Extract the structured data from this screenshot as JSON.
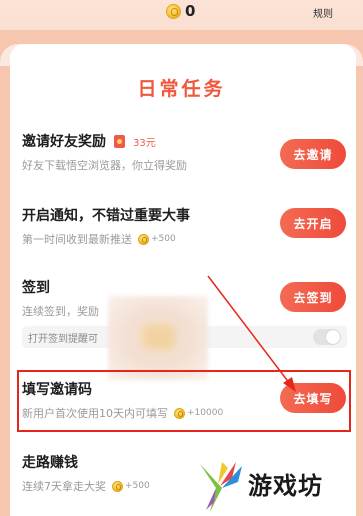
{
  "header": {
    "balance": "0",
    "rules_label": "规则"
  },
  "daily_tasks": {
    "title": "日常任务",
    "tasks": [
      {
        "title": "邀请好友奖励",
        "reward_label": "33元",
        "desc": "好友下载悟空浏览器，你立得奖励",
        "button": "去邀请"
      },
      {
        "title": "开启通知，不错过重要大事",
        "desc": "第一时间收到最新推送",
        "reward": "+500",
        "button": "去开启"
      },
      {
        "title": "签到",
        "desc": "连续签到，奖励",
        "button": "去签到",
        "toggle_label": "打开签到提醒可",
        "toggle_on": false
      },
      {
        "title": "填写邀请码",
        "desc": "新用户首次使用10天内可填写",
        "reward": "+10000",
        "button": "去填写"
      },
      {
        "title": "走路赚钱",
        "desc": "连续7天拿走大奖",
        "reward": "+500"
      }
    ]
  },
  "watermark": {
    "text": "游戏坊"
  },
  "colors": {
    "accent": "#f0583e",
    "button": "#ef4a3a",
    "highlight": "#e8251a",
    "coin": "#f6c237"
  },
  "icons": [
    "coin-icon",
    "red-envelope-icon",
    "annotation-arrow",
    "watermark-logo-icon"
  ]
}
